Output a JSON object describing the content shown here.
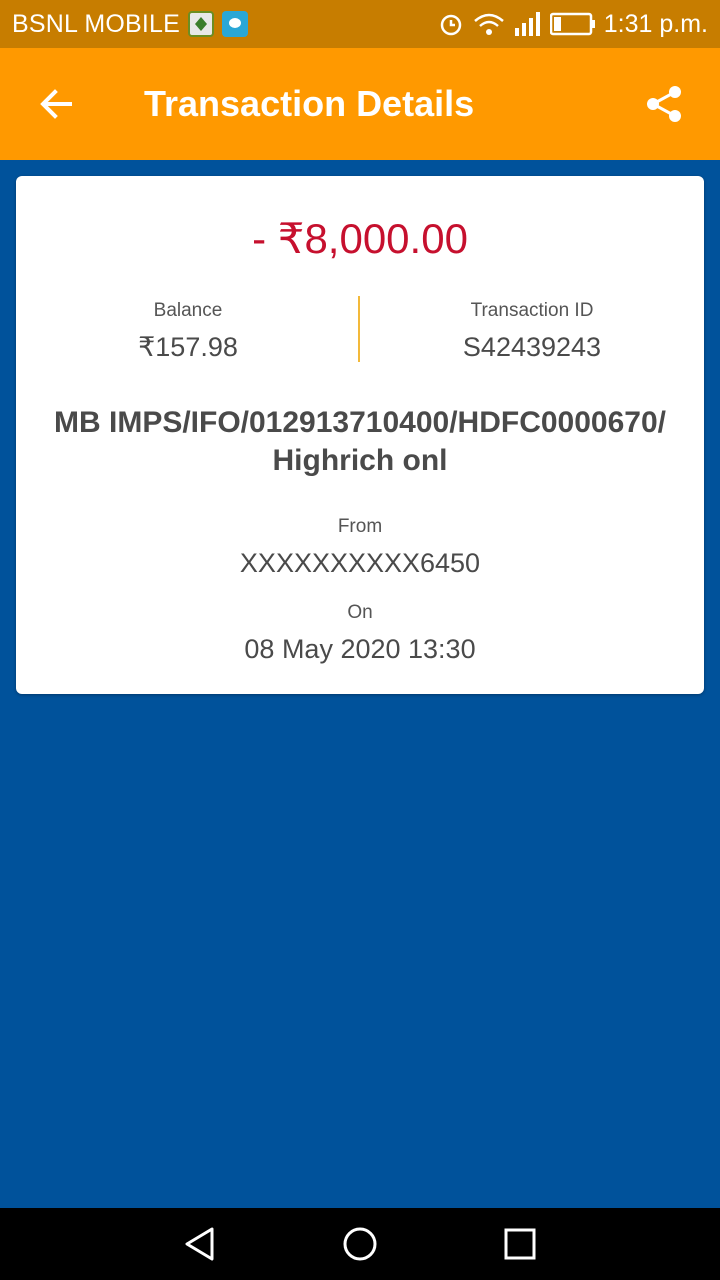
{
  "status_bar": {
    "carrier": "BSNL MOBILE",
    "time": "1:31 p.m."
  },
  "app_bar": {
    "title": "Transaction Details",
    "back_icon": "arrow-left-icon",
    "share_icon": "share-icon",
    "color": "#ff9900"
  },
  "transaction": {
    "amount": "- ₹8,000.00",
    "amount_color": "#c6102e",
    "balance_label": "Balance",
    "balance_value": "₹157.98",
    "txn_id_label": "Transaction ID",
    "txn_id_value": "S42439243",
    "description": "MB IMPS/IFO/012913710400/HDFC0000670/ Highrich onl",
    "from_label": "From",
    "from_value": "XXXXXXXXXX6450",
    "on_label": "On",
    "on_value": "08 May 2020 13:30"
  },
  "nav_bar": {
    "icons": [
      "back-triangle-icon",
      "home-circle-icon",
      "recents-square-icon"
    ]
  },
  "colors": {
    "background": "#00529b",
    "status_bar": "#c77d00"
  }
}
